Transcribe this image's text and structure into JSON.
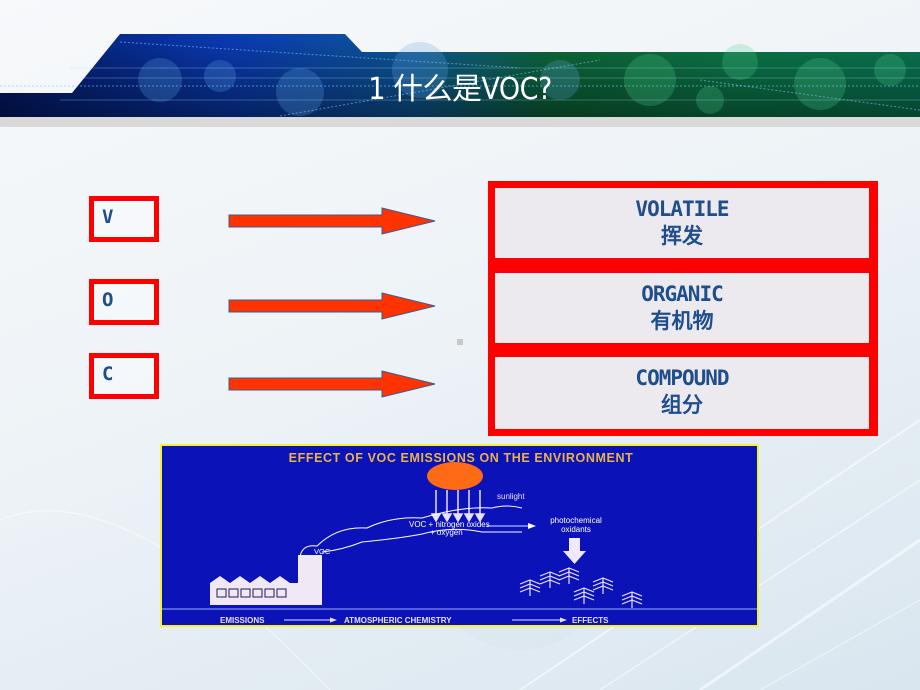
{
  "slide": {
    "title": "1 什么是VOC?",
    "colors": {
      "accent_red": "#ff0000",
      "text_blue": "#1f4e8c",
      "arrow_orange": "#ff3300",
      "diagram_bg": "#0b12b8"
    }
  },
  "letters": [
    {
      "letter": "V"
    },
    {
      "letter": "O"
    },
    {
      "letter": "C"
    }
  ],
  "definitions": [
    {
      "english": "VOLATILE",
      "chinese": "挥发"
    },
    {
      "english": "ORGANIC",
      "chinese": "有机物"
    },
    {
      "english": "COMPOUND",
      "chinese": "组分"
    }
  ],
  "diagram": {
    "title": "EFFECT OF VOC EMISSIONS ON THE ENVIRONMENT",
    "sunlight_label": "sunlight",
    "reaction_line1": "VOC + nitrogen oxides",
    "reaction_line2": "+ oxygen",
    "plume_label": "VOC",
    "product_line1": "photochemical",
    "product_line2": "oxidants",
    "footer": [
      "EMISSIONS",
      "ATMOSPHERIC CHEMISTRY",
      "EFFECTS"
    ]
  }
}
